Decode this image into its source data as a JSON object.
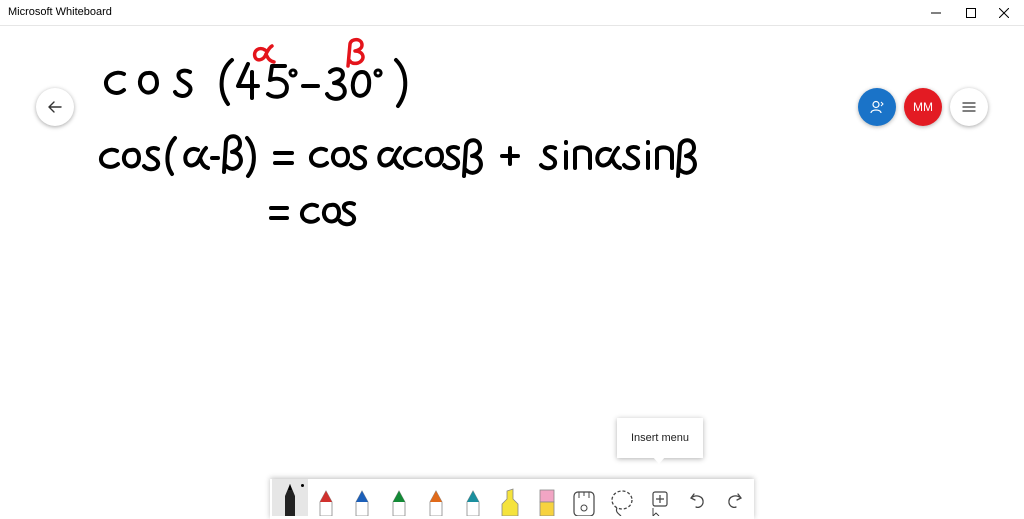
{
  "app": {
    "title": "Microsoft Whiteboard"
  },
  "window_controls": [
    "minimize",
    "maximize",
    "close"
  ],
  "header": {
    "back_icon": "arrow-left-icon",
    "share_icon": "invite-person-icon",
    "avatar_initials": "MM",
    "menu_icon": "hamburger-icon"
  },
  "canvas": {
    "handwriting": [
      "cos (45° − 30°)",
      "α",
      "β",
      "cos (α − β) = cos α cos β + sin α sin β",
      "= cos"
    ]
  },
  "tooltip": {
    "text": "Insert menu"
  },
  "toolbar": {
    "tools": [
      {
        "name": "pen-black",
        "color": "#111111"
      },
      {
        "name": "pen-red",
        "color": "#d0312d"
      },
      {
        "name": "pen-blue",
        "color": "#1c5fb8"
      },
      {
        "name": "pen-green",
        "color": "#138a36"
      },
      {
        "name": "pen-orange",
        "color": "#e06a1a"
      },
      {
        "name": "pen-teal",
        "color": "#1b8f9e"
      },
      {
        "name": "highlighter-yellow",
        "color": "#f5e33c"
      },
      {
        "name": "eraser",
        "color": "#f2a5c4"
      },
      {
        "name": "ruler-icon"
      },
      {
        "name": "lasso-icon"
      },
      {
        "name": "insert-icon"
      },
      {
        "name": "undo-icon"
      },
      {
        "name": "redo-icon"
      }
    ]
  },
  "colors": {
    "ink": "#000000",
    "red_ink": "#e4141b",
    "share_blue": "#1a73c8",
    "avatar_red": "#e31b23"
  }
}
